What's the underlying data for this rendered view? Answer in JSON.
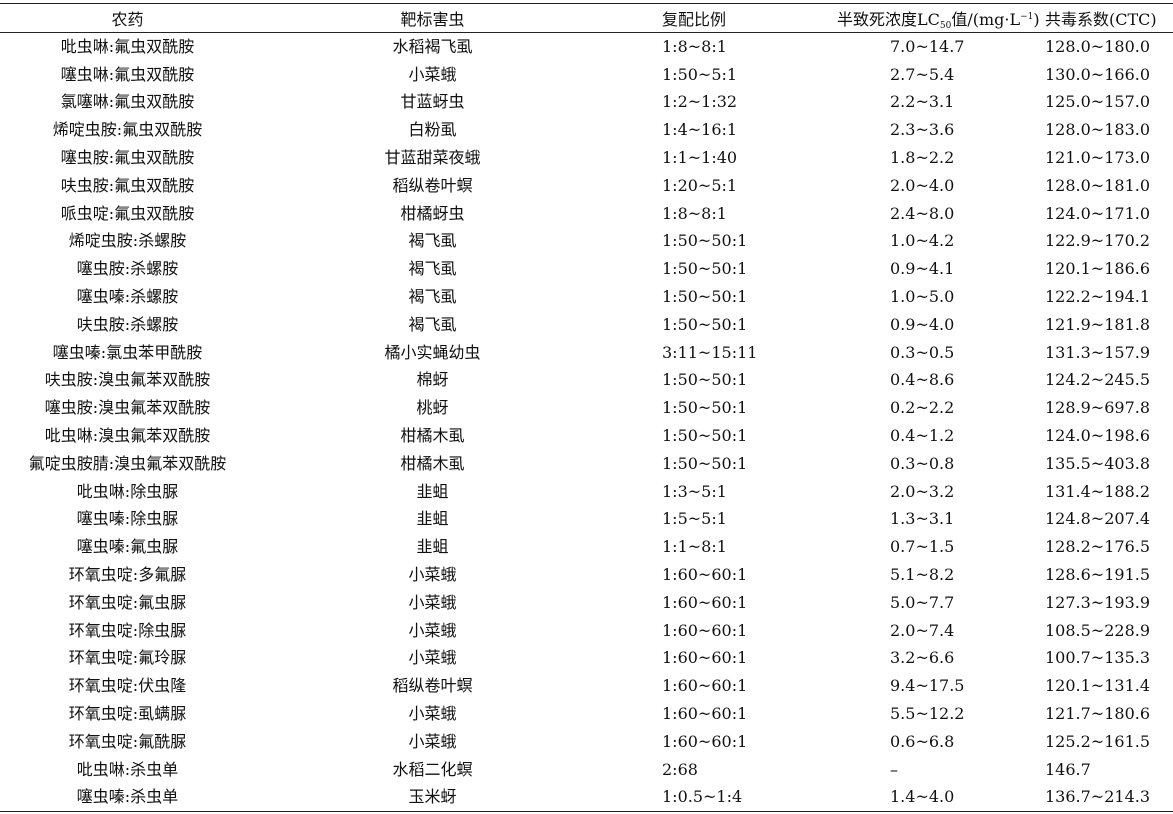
{
  "table": {
    "headers": {
      "pesticide": "农药",
      "target": "靶标害虫",
      "ratio": "复配比例",
      "lc50_prefix": "半致死浓度LC",
      "lc50_sub": "50",
      "lc50_mid": "值/(mg·L",
      "lc50_sup": "−1",
      "lc50_suffix": ")",
      "ctc": "共毒系数(CTC)"
    },
    "rows": [
      {
        "pesticide": "吡虫啉:氟虫双酰胺",
        "target": "水稻褐飞虱",
        "ratio": "1:8~8:1",
        "lc50": "7.0~14.7",
        "ctc": "128.0~180.0"
      },
      {
        "pesticide": "噻虫啉:氟虫双酰胺",
        "target": "小菜蛾",
        "ratio": "1:50~5:1",
        "lc50": "2.7~5.4",
        "ctc": "130.0~166.0"
      },
      {
        "pesticide": "氯噻啉:氟虫双酰胺",
        "target": "甘蓝蚜虫",
        "ratio": "1:2~1:32",
        "lc50": "2.2~3.1",
        "ctc": "125.0~157.0"
      },
      {
        "pesticide": "烯啶虫胺:氟虫双酰胺",
        "target": "白粉虱",
        "ratio": "1:4~16:1",
        "lc50": "2.3~3.6",
        "ctc": "128.0~183.0"
      },
      {
        "pesticide": "噻虫胺:氟虫双酰胺",
        "target": "甘蓝甜菜夜蛾",
        "ratio": "1:1~1:40",
        "lc50": "1.8~2.2",
        "ctc": "121.0~173.0"
      },
      {
        "pesticide": "呋虫胺:氟虫双酰胺",
        "target": "稻纵卷叶螟",
        "ratio": "1:20~5:1",
        "lc50": "2.0~4.0",
        "ctc": "128.0~181.0"
      },
      {
        "pesticide": "哌虫啶:氟虫双酰胺",
        "target": "柑橘蚜虫",
        "ratio": "1:8~8:1",
        "lc50": "2.4~8.0",
        "ctc": "124.0~171.0"
      },
      {
        "pesticide": "烯啶虫胺:杀螺胺",
        "target": "褐飞虱",
        "ratio": "1:50~50:1",
        "lc50": "1.0~4.2",
        "ctc": "122.9~170.2"
      },
      {
        "pesticide": "噻虫胺:杀螺胺",
        "target": "褐飞虱",
        "ratio": "1:50~50:1",
        "lc50": "0.9~4.1",
        "ctc": "120.1~186.6"
      },
      {
        "pesticide": "噻虫嗪:杀螺胺",
        "target": "褐飞虱",
        "ratio": "1:50~50:1",
        "lc50": "1.0~5.0",
        "ctc": "122.2~194.1"
      },
      {
        "pesticide": "呋虫胺:杀螺胺",
        "target": "褐飞虱",
        "ratio": "1:50~50:1",
        "lc50": "0.9~4.0",
        "ctc": "121.9~181.8"
      },
      {
        "pesticide": "噻虫嗪:氯虫苯甲酰胺",
        "target": "橘小实蝇幼虫",
        "ratio": "3:11~15:11",
        "lc50": "0.3~0.5",
        "ctc": "131.3~157.9"
      },
      {
        "pesticide": "呋虫胺:溴虫氟苯双酰胺",
        "target": "棉蚜",
        "ratio": "1:50~50:1",
        "lc50": "0.4~8.6",
        "ctc": "124.2~245.5"
      },
      {
        "pesticide": "噻虫胺:溴虫氟苯双酰胺",
        "target": "桃蚜",
        "ratio": "1:50~50:1",
        "lc50": "0.2~2.2",
        "ctc": "128.9~697.8"
      },
      {
        "pesticide": "吡虫啉:溴虫氟苯双酰胺",
        "target": "柑橘木虱",
        "ratio": "1:50~50:1",
        "lc50": "0.4~1.2",
        "ctc": "124.0~198.6"
      },
      {
        "pesticide": "氟啶虫胺腈:溴虫氟苯双酰胺",
        "target": "柑橘木虱",
        "ratio": "1:50~50:1",
        "lc50": "0.3~0.8",
        "ctc": "135.5~403.8"
      },
      {
        "pesticide": "吡虫啉:除虫脲",
        "target": "韭蛆",
        "ratio": "1:3~5:1",
        "lc50": "2.0~3.2",
        "ctc": "131.4~188.2"
      },
      {
        "pesticide": "噻虫嗪:除虫脲",
        "target": "韭蛆",
        "ratio": "1:5~5:1",
        "lc50": "1.3~3.1",
        "ctc": "124.8~207.4"
      },
      {
        "pesticide": "噻虫嗪:氟虫脲",
        "target": "韭蛆",
        "ratio": "1:1~8:1",
        "lc50": "0.7~1.5",
        "ctc": "128.2~176.5"
      },
      {
        "pesticide": "环氧虫啶:多氟脲",
        "target": "小菜蛾",
        "ratio": "1:60~60:1",
        "lc50": "5.1~8.2",
        "ctc": "128.6~191.5"
      },
      {
        "pesticide": "环氧虫啶:氟虫脲",
        "target": "小菜蛾",
        "ratio": "1:60~60:1",
        "lc50": "5.0~7.7",
        "ctc": "127.3~193.9"
      },
      {
        "pesticide": "环氧虫啶:除虫脲",
        "target": "小菜蛾",
        "ratio": "1:60~60:1",
        "lc50": "2.0~7.4",
        "ctc": "108.5~228.9"
      },
      {
        "pesticide": "环氧虫啶:氟玲脲",
        "target": "小菜蛾",
        "ratio": "1:60~60:1",
        "lc50": "3.2~6.6",
        "ctc": "100.7~135.3"
      },
      {
        "pesticide": "环氧虫啶:伏虫隆",
        "target": "稻纵卷叶螟",
        "ratio": "1:60~60:1",
        "lc50": "9.4~17.5",
        "ctc": "120.1~131.4"
      },
      {
        "pesticide": "环氧虫啶:虱螨脲",
        "target": "小菜蛾",
        "ratio": "1:60~60:1",
        "lc50": "5.5~12.2",
        "ctc": "121.7~180.6"
      },
      {
        "pesticide": "环氧虫啶:氟酰脲",
        "target": "小菜蛾",
        "ratio": "1:60~60:1",
        "lc50": "0.6~6.8",
        "ctc": "125.2~161.5"
      },
      {
        "pesticide": "吡虫啉:杀虫单",
        "target": "水稻二化螟",
        "ratio": "2:68",
        "lc50": "–",
        "ctc": "146.7"
      },
      {
        "pesticide": "噻虫嗪:杀虫单",
        "target": "玉米蚜",
        "ratio": "1:0.5~1:4",
        "lc50": "1.4~4.0",
        "ctc": "136.7~214.3"
      }
    ]
  }
}
